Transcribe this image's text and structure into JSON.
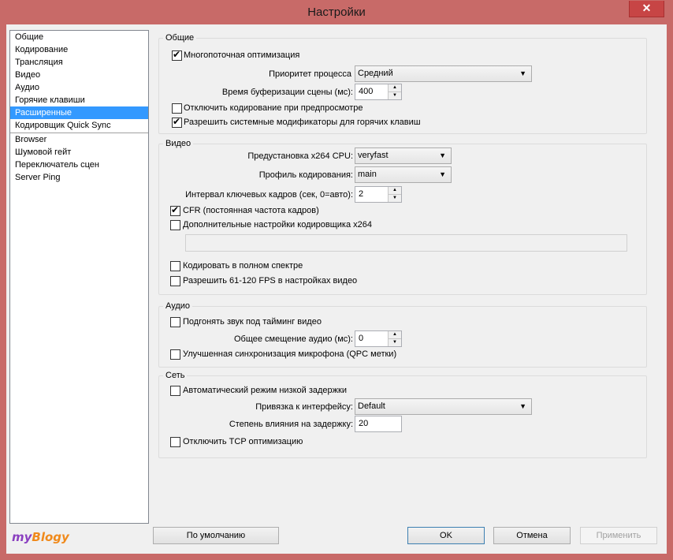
{
  "window": {
    "title": "Настройки",
    "close_glyph": "✕"
  },
  "sidebar": {
    "items": [
      "Общие",
      "Кодирование",
      "Трансляция",
      "Видео",
      "Аудио",
      "Горячие клавиши",
      "Расширенные",
      "Кодировщик Quick Sync"
    ],
    "items_after_separator": [
      "Browser",
      "Шумовой гейт",
      "Переключатель сцен",
      "Server Ping"
    ],
    "selected": "Расширенные",
    "selected_color": "#3399ff"
  },
  "general": {
    "label": "Общие",
    "multithread": "Многопоточная оптимизация",
    "priority_label": "Приоритет процесса",
    "priority_value": "Средний",
    "buffer_label": "Время буферизации сцены (мс):",
    "buffer_value": "400",
    "disable_preview_encoding": "Отключить кодирование при предпросмотре",
    "allow_modifiers": "Разрешить системные модификаторы для горячих клавиш"
  },
  "video": {
    "label": "Видео",
    "preset_label": "Предустановка x264 CPU:",
    "preset_value": "veryfast",
    "profile_label": "Профиль кодирования:",
    "profile_value": "main",
    "keyframe_label": "Интервал ключевых кадров (сек, 0=авто):",
    "keyframe_value": "2",
    "cfr": "CFR (постоянная частота кадров)",
    "custom_x264": "Дополнительные настройки кодировщика x264",
    "full_range": "Кодировать в полном спектре",
    "allow_fps": "Разрешить 61-120 FPS в настройках видео"
  },
  "audio": {
    "label": "Аудио",
    "sync_to_video": "Подгонять звук под тайминг видео",
    "offset_label": "Общее смещение аудио (мс):",
    "offset_value": "0",
    "mic_sync": "Улучшенная синхронизация микрофона (QPC метки)"
  },
  "network": {
    "label": "Сеть",
    "low_latency": "Автоматический режим низкой задержки",
    "bind_label": "Привязка к интерфейсу:",
    "bind_value": "Default",
    "latency_factor_label": "Степень влияния на задержку:",
    "latency_factor_value": "20",
    "disable_tcp": "Отключить TCP оптимизацию"
  },
  "buttons": {
    "defaults": "По умолчанию",
    "ok": "OK",
    "cancel": "Отмена",
    "apply": "Применить"
  },
  "watermark": {
    "part1": "my",
    "part2": "Blogy",
    "color1": "#8a3fc0",
    "color2": "#f08a1c"
  }
}
